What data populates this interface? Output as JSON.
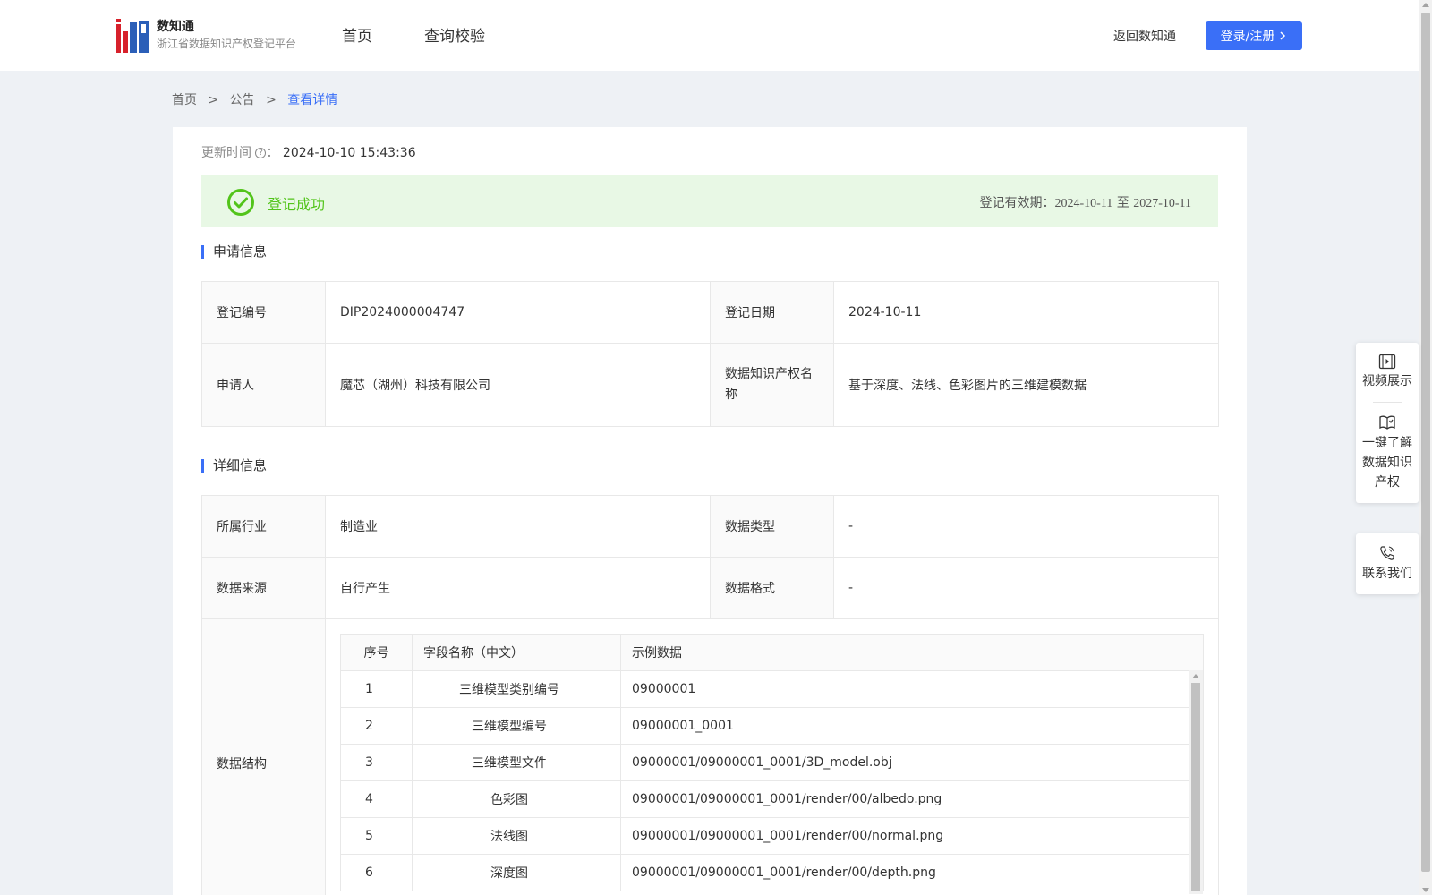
{
  "header": {
    "logo_title": "数知通",
    "logo_subtitle": "浙江省数据知识产权登记平台",
    "nav": [
      "首页",
      "查询校验"
    ],
    "back_link": "返回数知通",
    "login_button": "登录/注册"
  },
  "breadcrumb": [
    "首页",
    ">",
    "公告",
    ">",
    "查看详情"
  ],
  "update": {
    "label": "更新时间",
    "value": "2024-10-10 15:43:36"
  },
  "status": {
    "text": "登记成功",
    "validity_label": "登记有效期：",
    "validity_start": "2024-10-11",
    "validity_sep": "至",
    "validity_end": "2027-10-11",
    "color": "#52c41a"
  },
  "application": {
    "title": "申请信息",
    "reg_no_label": "登记编号",
    "reg_no": "DIP2024000004747",
    "reg_date_label": "登记日期",
    "reg_date": "2024-10-11",
    "applicant_label": "申请人",
    "applicant": "魔芯（湖州）科技有限公司",
    "ip_name_label": "数据知识产权名称",
    "ip_name": "基于深度、法线、色彩图片的三维建模数据"
  },
  "details": {
    "title": "详细信息",
    "industry_label": "所属行业",
    "industry": "制造业",
    "data_type_label": "数据类型",
    "data_type": "-",
    "source_label": "数据来源",
    "source": "自行产生",
    "format_label": "数据格式",
    "format": "-",
    "structure_label": "数据结构",
    "columns": [
      "序号",
      "字段名称（中文）",
      "示例数据"
    ],
    "rows": [
      {
        "no": "1",
        "name": "三维模型类别编号",
        "sample": "09000001"
      },
      {
        "no": "2",
        "name": "三维模型编号",
        "sample": "09000001_0001"
      },
      {
        "no": "3",
        "name": "三维模型文件",
        "sample": "09000001/09000001_0001/3D_model.obj"
      },
      {
        "no": "4",
        "name": "色彩图",
        "sample": "09000001/09000001_0001/render/00/albedo.png"
      },
      {
        "no": "5",
        "name": "法线图",
        "sample": "09000001/09000001_0001/render/00/normal.png"
      },
      {
        "no": "6",
        "name": "深度图",
        "sample": "09000001/09000001_0001/render/00/depth.png"
      }
    ]
  },
  "float_panel": {
    "video": "视频展示",
    "learn": [
      "一键了解",
      "数据知识",
      "产权"
    ],
    "contact": "联系我们"
  },
  "colors": {
    "accent": "#3a6ff7",
    "success_bg": "#e8f8e5"
  }
}
